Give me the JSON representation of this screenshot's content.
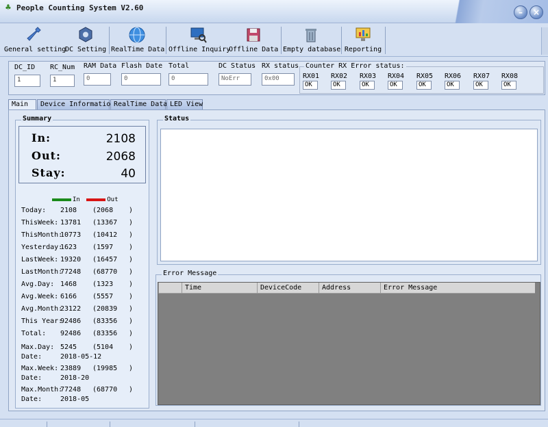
{
  "window": {
    "title": "People Counting System  V2.60",
    "min_icon": "minimize-icon",
    "close_icon": "close-icon"
  },
  "toolbar": [
    {
      "label": "General setting",
      "icon": "wrench-icon"
    },
    {
      "label": "DC Setting",
      "icon": "gear-nut-icon"
    },
    {
      "label": "RealTime Data",
      "icon": "globe-icon"
    },
    {
      "label": "Offline Inquiry",
      "icon": "computer-search-icon"
    },
    {
      "label": "Offline Data",
      "icon": "floppy-disk-icon"
    },
    {
      "label": "Empty database",
      "icon": "trash-icon"
    },
    {
      "label": "Reporting",
      "icon": "monitor-chart-icon"
    }
  ],
  "device_status": {
    "dc_id": {
      "label": "DC_ID",
      "value": "1"
    },
    "rc_num": {
      "label": "RC_Num",
      "value": "1"
    },
    "ram_data": {
      "label": "RAM Data",
      "value": "0"
    },
    "flash_date": {
      "label": "Flash Date",
      "value": "0"
    },
    "total": {
      "label": "Total",
      "value": "0"
    },
    "dc_status": {
      "label": "DC Status",
      "value": "NoErr"
    },
    "rx_status": {
      "label": "RX status",
      "value": "0x00"
    }
  },
  "counter_rx": {
    "legend": "Counter RX Error status:",
    "items": [
      {
        "label": "RX01",
        "value": "OK"
      },
      {
        "label": "RX02",
        "value": "OK"
      },
      {
        "label": "RX03",
        "value": "OK"
      },
      {
        "label": "RX04",
        "value": "OK"
      },
      {
        "label": "RX05",
        "value": "OK"
      },
      {
        "label": "RX06",
        "value": "OK"
      },
      {
        "label": "RX07",
        "value": "OK"
      },
      {
        "label": "RX08",
        "value": "OK"
      }
    ]
  },
  "tabs": [
    {
      "label": "Main",
      "active": true
    },
    {
      "label": "Device Information",
      "active": false
    },
    {
      "label": "RealTime Data",
      "active": false
    },
    {
      "label": "LED View",
      "active": false
    }
  ],
  "summary": {
    "title": "Summary",
    "in_label": "In:",
    "in_value": "2108",
    "out_label": "Out:",
    "out_value": "2068",
    "stay_label": "Stay:",
    "stay_value": "40",
    "legend_in": "In",
    "legend_out": "Out",
    "legend_in_color": "#1a8a1a",
    "legend_out_color": "#d81414",
    "stats": [
      {
        "label": "Today:",
        "in": "2108",
        "out": "(2068",
        "close": ")"
      },
      {
        "label": "ThisWeek:",
        "in": "13781",
        "out": "(13367",
        "close": ")"
      },
      {
        "label": "ThisMonth:",
        "in": "10773",
        "out": "(10412",
        "close": ")"
      },
      {
        "label": "Yesterday:",
        "in": "1623",
        "out": "(1597",
        "close": ")"
      },
      {
        "label": "LastWeek:",
        "in": "19320",
        "out": "(16457",
        "close": ")"
      },
      {
        "label": "LastMonth:",
        "in": "77248",
        "out": "(68770",
        "close": ")"
      },
      {
        "label": "Avg.Day:",
        "in": "1468",
        "out": "(1323",
        "close": ")"
      },
      {
        "label": "Avg.Week:",
        "in": "6166",
        "out": "(5557",
        "close": ")"
      },
      {
        "label": "Avg.Month:",
        "in": "23122",
        "out": "(20839",
        "close": ")"
      },
      {
        "label": "This Year:",
        "in": "92486",
        "out": "(83356",
        "close": ")"
      },
      {
        "label": "Total:",
        "in": "92486",
        "out": "(83356",
        "close": ")"
      }
    ],
    "max_stats": [
      {
        "label": "Max.Day:",
        "in": "5245",
        "out": "(5104",
        "close": ")",
        "date_label": "Date:",
        "date": "2018-05-12"
      },
      {
        "label": "Max.Week:",
        "in": "23889",
        "out": "(19985",
        "close": ")",
        "date_label": "Date:",
        "date": "2018-20"
      },
      {
        "label": "Max.Month:",
        "in": "77248",
        "out": "(68770",
        "close": ")",
        "date_label": "Date:",
        "date": "2018-05"
      }
    ]
  },
  "status_panel": {
    "title": "Status"
  },
  "error_panel": {
    "title": "Error Message",
    "columns": [
      "Time",
      "DeviceCode",
      "Address",
      "Error Message"
    ]
  }
}
